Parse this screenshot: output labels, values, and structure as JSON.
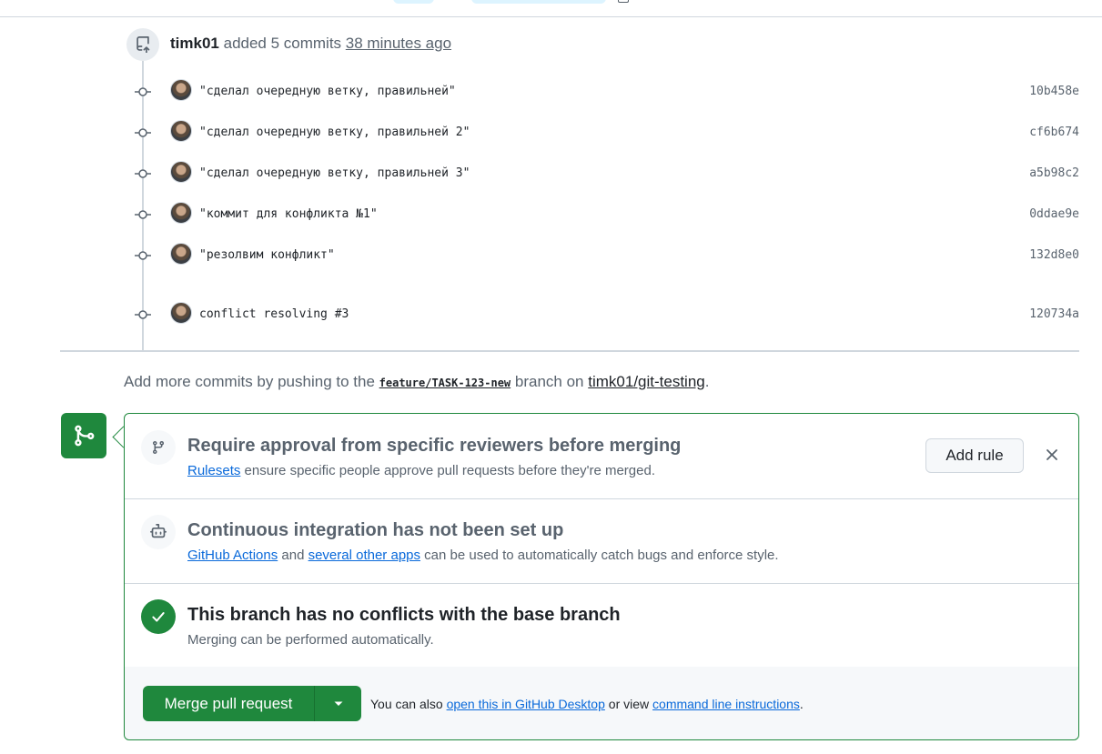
{
  "timeline": {
    "user": "timk01",
    "action": "added 5 commits",
    "time": "38 minutes ago"
  },
  "commits": [
    {
      "message": "\"сделал очередную ветку, правильней\"",
      "sha": "10b458e"
    },
    {
      "message": "\"сделал очередную ветку, правильней 2\"",
      "sha": "cf6b674"
    },
    {
      "message": "\"сделал очередную ветку, правильней 3\"",
      "sha": "a5b98c2"
    },
    {
      "message": "\"коммит для конфликта №1\"",
      "sha": "0ddae9e"
    },
    {
      "message": "\"резолвим конфликт\"",
      "sha": "132d8e0"
    },
    {
      "message": "conflict resolving #3",
      "sha": "120734a"
    }
  ],
  "push_hint": {
    "prefix": "Add more commits by pushing to the",
    "branch": "feature/TASK-123-new",
    "middle": "branch on",
    "repo": "timk01/git-testing",
    "suffix": "."
  },
  "merge_box": {
    "review": {
      "title": "Require approval from specific reviewers before merging",
      "link": "Rulesets",
      "desc": "ensure specific people approve pull requests before they're merged.",
      "button": "Add rule",
      "close": "✕"
    },
    "ci": {
      "title": "Continuous integration has not been set up",
      "link1": "GitHub Actions",
      "mid": "and",
      "link2": "several other apps",
      "desc": "can be used to automatically catch bugs and enforce style."
    },
    "conflicts": {
      "title": "This branch has no conflicts with the base branch",
      "desc": "Merging can be performed automatically."
    },
    "footer": {
      "button": "Merge pull request",
      "text1": "You can also",
      "link1": "open this in GitHub Desktop",
      "text2": "or view",
      "link2": "command line instructions",
      "text3": "."
    }
  },
  "colors": {
    "green": "#1f883d",
    "link": "#0969da",
    "muted": "#59636e"
  },
  "icons": {
    "push": "repo-push-icon",
    "commit": "git-commit-icon",
    "merge": "git-merge-icon",
    "branch": "git-branch-icon",
    "ci": "robot-icon",
    "check": "check-icon",
    "caret": "triangle-down-icon"
  }
}
